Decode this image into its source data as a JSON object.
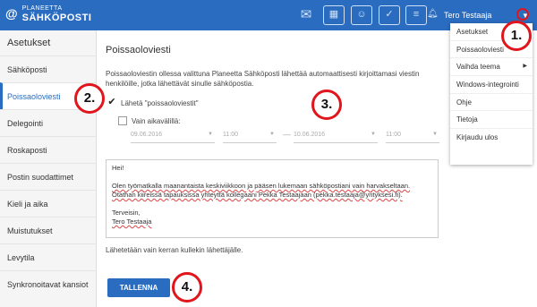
{
  "brand": {
    "line1": "PLANEETTA",
    "line2": "SÄHKÖPOSTI",
    "at": "@"
  },
  "topbar": {
    "icons": [
      "mail-icon",
      "calendar-icon",
      "contacts-icon",
      "tasks-icon",
      "notes-icon",
      "bell-icon"
    ],
    "user_name": "Tero Testaaja"
  },
  "sidebar": {
    "title": "Asetukset",
    "items": [
      {
        "label": "Sähköposti",
        "active": false
      },
      {
        "label": "Poissaoloviesti",
        "active": true
      },
      {
        "label": "Delegointi",
        "active": false
      },
      {
        "label": "Roskaposti",
        "active": false
      },
      {
        "label": "Postin suodattimet",
        "active": false
      },
      {
        "label": "Kieli ja aika",
        "active": false
      },
      {
        "label": "Muistutukset",
        "active": false
      },
      {
        "label": "Levytila",
        "active": false
      },
      {
        "label": "Synkronoitavat kansiot",
        "active": false
      }
    ]
  },
  "main": {
    "title": "Poissaoloviesti",
    "description": "Poissaoloviestin ollessa valittuna Planeetta Sähköposti lähettää automaattisesti kirjoittamasi viestin henkilöille, jotka lähettävät sinulle sähköpostia.",
    "send_label": "Lähetä \"poissaoloviestit\"",
    "send_checked": true,
    "period_label": "Vain aikavälillä:",
    "period_checked": false,
    "start_date": "09.06.2016",
    "start_time": "11:00",
    "end_date": "10.06.2016",
    "end_time": "11:00",
    "message": {
      "greeting": "Hei!",
      "body1": "Olen työmatkalla maanantaista keskiviikkoon ja pääsen lukemaan sähköpostiani vain harvakseltaan.",
      "body2": "Otathan kiireissä tapauksissa yhteyttä kollegaani Pekka Testaajaan (pekka.testaaja@yrityksesi.fi).",
      "closing": "Terveisin,",
      "signature": "Tero Testaaja"
    },
    "footnote": "Lähetetään vain kerran kullekin lähettäjälle.",
    "save_label": "TALLENNA"
  },
  "dropdown": {
    "items": [
      {
        "label": "Asetukset",
        "submenu": false
      },
      {
        "label": "Poissaoloviesti",
        "submenu": false
      },
      {
        "label": "Vaihda teema",
        "submenu": true
      },
      {
        "label": "Windows-integrointi",
        "submenu": false
      },
      {
        "label": "Ohje",
        "submenu": false
      },
      {
        "label": "Tietoja",
        "submenu": false
      },
      {
        "label": "Kirjaudu ulos",
        "submenu": false
      }
    ]
  },
  "callouts": {
    "c1": "1.",
    "c2": "2.",
    "c3": "3.",
    "c4": "4."
  },
  "colors": {
    "accent": "#2a6cc0",
    "callout": "#e0161c"
  }
}
